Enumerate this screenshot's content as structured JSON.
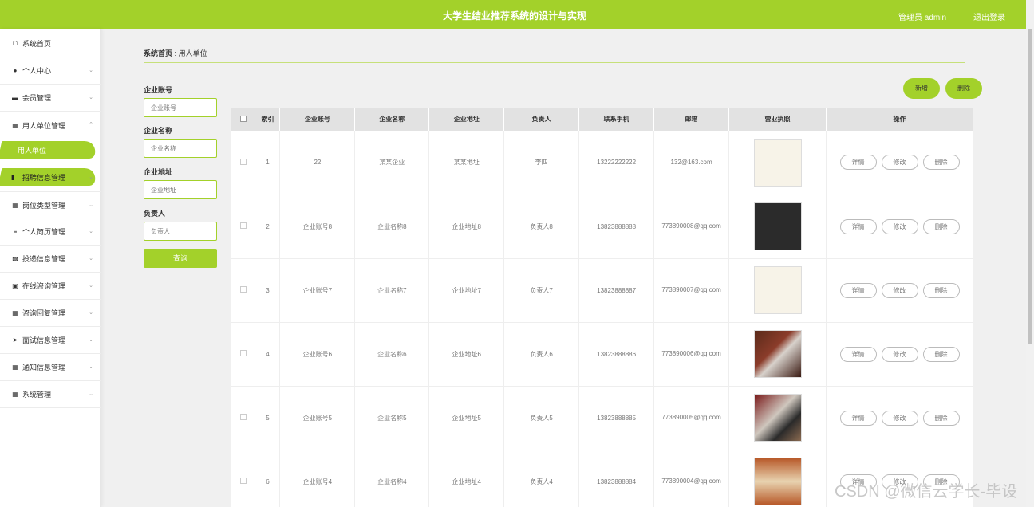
{
  "header": {
    "title": "大学生结业推荐系统的设计与实现",
    "admin": "管理员 admin",
    "logout": "退出登录"
  },
  "sidebar": {
    "items": [
      {
        "label": "系统首页",
        "icon": "home-icon"
      },
      {
        "label": "个人中心",
        "icon": "user-icon"
      },
      {
        "label": "会员管理",
        "icon": "chat-icon"
      },
      {
        "label": "用人单位管理",
        "icon": "building-icon"
      },
      {
        "label": "用人单位",
        "icon": ""
      },
      {
        "label": "招聘信息管理",
        "icon": "bar-icon"
      },
      {
        "label": "岗位类型管理",
        "icon": "grid-icon"
      },
      {
        "label": "个人简历管理",
        "icon": "sliders-icon"
      },
      {
        "label": "投递信息管理",
        "icon": "chart-icon"
      },
      {
        "label": "在线咨询管理",
        "icon": "monitor-icon"
      },
      {
        "label": "咨询回复管理",
        "icon": "grid-icon"
      },
      {
        "label": "面试信息管理",
        "icon": "send-icon"
      },
      {
        "label": "通知信息管理",
        "icon": "grid-icon"
      },
      {
        "label": "系统管理",
        "icon": "grid-icon"
      }
    ]
  },
  "breadcrumb": {
    "home": "系统首页",
    "sep": ":",
    "current": "用人单位"
  },
  "search": {
    "account_label": "企业账号",
    "account_placeholder": "企业账号",
    "name_label": "企业名称",
    "name_placeholder": "企业名称",
    "address_label": "企业地址",
    "address_placeholder": "企业地址",
    "manager_label": "负责人",
    "manager_placeholder": "负责人",
    "query_button": "查询"
  },
  "actions": {
    "add": "新增",
    "delete": "删除"
  },
  "table": {
    "headers": [
      "索引",
      "企业账号",
      "企业名称",
      "企业地址",
      "负责人",
      "联系手机",
      "邮箱",
      "营业执照",
      "操作"
    ],
    "row_buttons": {
      "detail": "详情",
      "edit": "修改",
      "delete": "删除"
    },
    "rows": [
      {
        "index": "1",
        "account": "22",
        "name": "某某企业",
        "address": "某某地址",
        "manager": "李四",
        "phone": "13222222222",
        "email": "132@163.com"
      },
      {
        "index": "2",
        "account": "企业账号8",
        "name": "企业名称8",
        "address": "企业地址8",
        "manager": "负责人8",
        "phone": "13823888888",
        "email": "773890008@qq.com"
      },
      {
        "index": "3",
        "account": "企业账号7",
        "name": "企业名称7",
        "address": "企业地址7",
        "manager": "负责人7",
        "phone": "13823888887",
        "email": "773890007@qq.com"
      },
      {
        "index": "4",
        "account": "企业账号6",
        "name": "企业名称6",
        "address": "企业地址6",
        "manager": "负责人6",
        "phone": "13823888886",
        "email": "773890006@qq.com"
      },
      {
        "index": "5",
        "account": "企业账号5",
        "name": "企业名称5",
        "address": "企业地址5",
        "manager": "负责人5",
        "phone": "13823888885",
        "email": "773890005@qq.com"
      },
      {
        "index": "6",
        "account": "企业账号4",
        "name": "企业名称4",
        "address": "企业地址4",
        "manager": "负责人4",
        "phone": "13823888884",
        "email": "773890004@qq.com"
      }
    ]
  },
  "watermark": "CSDN @微信云学长-毕设"
}
